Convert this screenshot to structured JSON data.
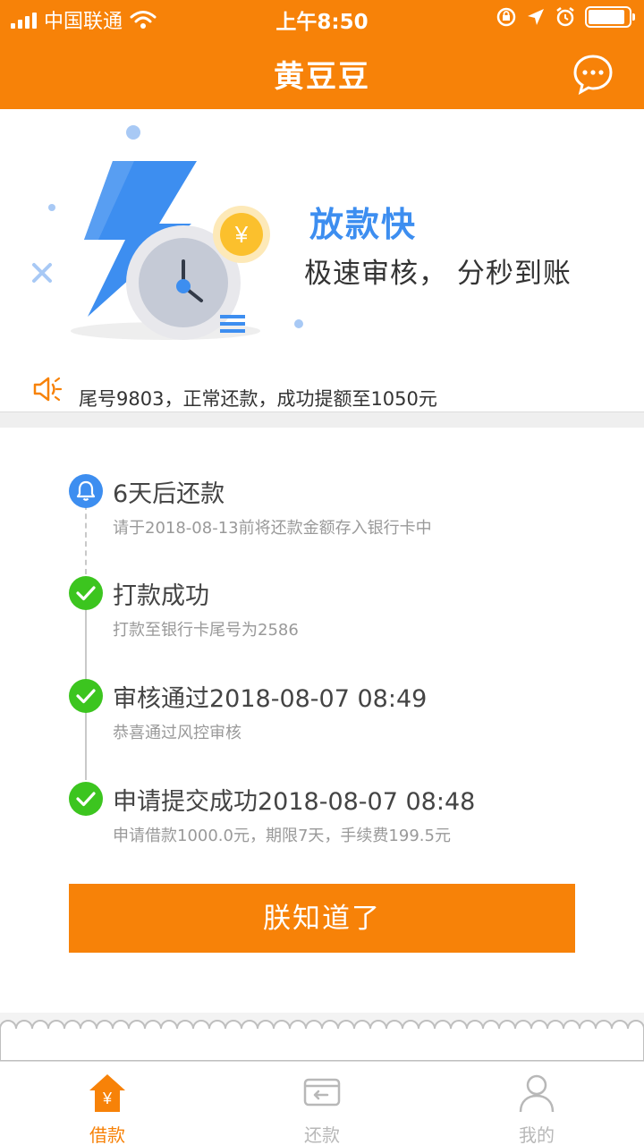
{
  "status_bar": {
    "carrier": "中国联通",
    "time": "上午8:50"
  },
  "nav": {
    "title": "黄豆豆"
  },
  "banner": {
    "title": "放款快",
    "subtitle": "极速审核， 分秒到账",
    "coin_symbol": "¥"
  },
  "notice": {
    "text": "尾号9803，正常还款，成功提额至1050元"
  },
  "timeline": [
    {
      "title": "6天后还款",
      "desc": "请于2018-08-13前将还款金额存入银行卡中",
      "status": "pending"
    },
    {
      "title": "打款成功",
      "desc": "打款至银行卡尾号为2586",
      "status": "done"
    },
    {
      "title": "审核通过2018-08-07 08:49",
      "desc": "恭喜通过风控审核",
      "status": "done"
    },
    {
      "title": "申请提交成功2018-08-07 08:48",
      "desc": "申请借款1000.0元，期限7天，手续费199.5元",
      "status": "done"
    }
  ],
  "confirm_button": {
    "label": "朕知道了"
  },
  "tabbar": {
    "items": [
      {
        "label": "借款",
        "icon": "loan-house-icon",
        "active": true
      },
      {
        "label": "还款",
        "icon": "repay-card-icon",
        "active": false
      },
      {
        "label": "我的",
        "icon": "profile-icon",
        "active": false
      }
    ]
  },
  "colors": {
    "brand_orange": "#f78208",
    "accent_blue": "#3d8ef0",
    "success_green": "#3cc51f"
  }
}
